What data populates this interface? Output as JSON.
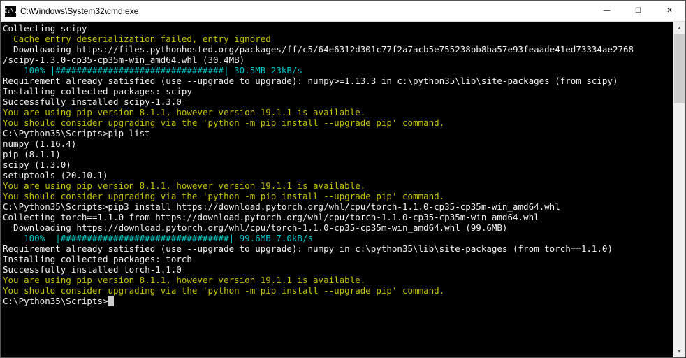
{
  "window": {
    "icon_text": "C:\\.",
    "title": "C:\\Windows\\System32\\cmd.exe",
    "minimize_glyph": "—",
    "maximize_glyph": "☐",
    "close_glyph": "✕"
  },
  "scrollbar": {
    "up_glyph": "▴",
    "down_glyph": "▾"
  },
  "terminal_lines": [
    {
      "cls": "c-white",
      "t": "Collecting scipy"
    },
    {
      "cls": "c-yellow",
      "t": "  Cache entry deserialization failed, entry ignored"
    },
    {
      "cls": "c-white",
      "t": "  Downloading https://files.pythonhosted.org/packages/ff/c5/64e6312d301c77f2a7acb5e755238bb8ba57e93feaade41ed73334ae2768"
    },
    {
      "cls": "c-white",
      "t": "/scipy-1.3.0-cp35-cp35m-win_amd64.whl (30.4MB)"
    },
    {
      "cls": "c-cyan",
      "t": "    100% |################################| 30.5MB 23kB/s"
    },
    {
      "cls": "c-white",
      "t": "Requirement already satisfied (use --upgrade to upgrade): numpy>=1.13.3 in c:\\python35\\lib\\site-packages (from scipy)"
    },
    {
      "cls": "c-white",
      "t": "Installing collected packages: scipy"
    },
    {
      "cls": "c-white",
      "t": "Successfully installed scipy-1.3.0"
    },
    {
      "cls": "c-yellow",
      "t": "You are using pip version 8.1.1, however version 19.1.1 is available."
    },
    {
      "cls": "c-yellow",
      "t": "You should consider upgrading via the 'python -m pip install --upgrade pip' command."
    },
    {
      "cls": "c-white",
      "t": ""
    },
    {
      "cls": "c-white",
      "t": "C:\\Python35\\Scripts>pip list"
    },
    {
      "cls": "c-white",
      "t": "numpy (1.16.4)"
    },
    {
      "cls": "c-white",
      "t": "pip (8.1.1)"
    },
    {
      "cls": "c-white",
      "t": "scipy (1.3.0)"
    },
    {
      "cls": "c-white",
      "t": "setuptools (20.10.1)"
    },
    {
      "cls": "c-yellow",
      "t": "You are using pip version 8.1.1, however version 19.1.1 is available."
    },
    {
      "cls": "c-yellow",
      "t": "You should consider upgrading via the 'python -m pip install --upgrade pip' command."
    },
    {
      "cls": "c-white",
      "t": ""
    },
    {
      "cls": "c-white",
      "t": "C:\\Python35\\Scripts>pip3 install https://download.pytorch.org/whl/cpu/torch-1.1.0-cp35-cp35m-win_amd64.whl"
    },
    {
      "cls": "c-white",
      "t": "Collecting torch==1.1.0 from https://download.pytorch.org/whl/cpu/torch-1.1.0-cp35-cp35m-win_amd64.whl"
    },
    {
      "cls": "c-white",
      "t": "  Downloading https://download.pytorch.org/whl/cpu/torch-1.1.0-cp35-cp35m-win_amd64.whl (99.6MB)"
    },
    {
      "cls": "c-cyan",
      "t": "    100%  |################################| 99.6MB 7.0kB/s"
    },
    {
      "cls": "c-white",
      "t": "Requirement already satisfied (use --upgrade to upgrade): numpy in c:\\python35\\lib\\site-packages (from torch==1.1.0)"
    },
    {
      "cls": "c-white",
      "t": "Installing collected packages: torch"
    },
    {
      "cls": "c-white",
      "t": "Successfully installed torch-1.1.0"
    },
    {
      "cls": "c-yellow",
      "t": "You are using pip version 8.1.1, however version 19.1.1 is available."
    },
    {
      "cls": "c-yellow",
      "t": "You should consider upgrading via the 'python -m pip install --upgrade pip' command."
    },
    {
      "cls": "c-white",
      "t": ""
    }
  ],
  "prompt": {
    "path": "C:\\Python35\\Scripts>"
  }
}
